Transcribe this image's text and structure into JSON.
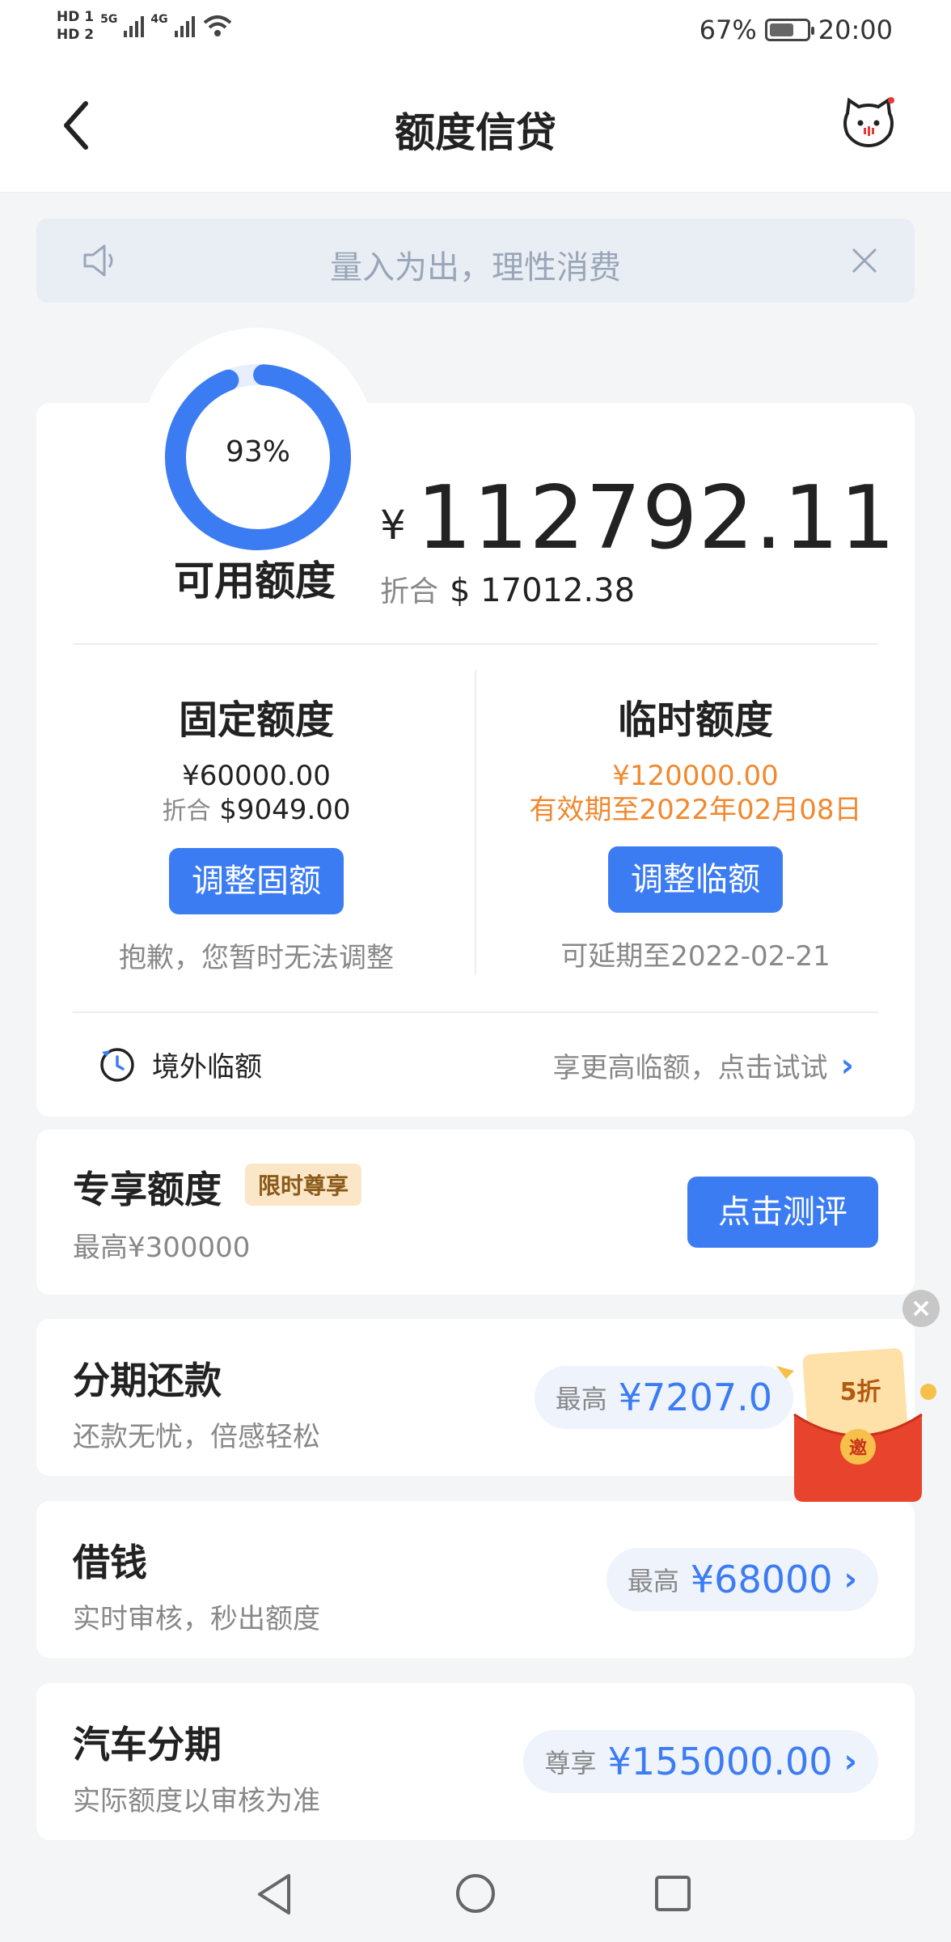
{
  "status_bar": {
    "hd1": "HD 1",
    "hd2": "HD 2",
    "net1": "5G",
    "net2": "4G",
    "battery": "67%",
    "battery_level": 0.67,
    "time": "20:00"
  },
  "header": {
    "title": "额度信贷"
  },
  "notice": {
    "text": "量入为出，理性消费"
  },
  "credit": {
    "ring_percent_label": "93%",
    "ring_percent": 93,
    "available_label": "可用额度",
    "currency_symbol": "¥",
    "available_amount": "112792.11",
    "usd_label": "折合",
    "usd_amount": "$ 17012.38"
  },
  "fixed": {
    "title": "固定额度",
    "amount": "¥60000.00",
    "usd_label": "折合",
    "usd_amount": "$9049.00",
    "button": "调整固额",
    "note": "抱歉，您暂时无法调整"
  },
  "temp": {
    "title": "临时额度",
    "amount": "¥120000.00",
    "validity": "有效期至2022年02月08日",
    "button": "调整临额",
    "note": "可延期至2022-02-21"
  },
  "overseas": {
    "label": "境外临额",
    "link": "享更高临额，点击试试"
  },
  "exclusive": {
    "title": "专享额度",
    "tag": "限时尊享",
    "sub": "最高¥300000",
    "button": "点击测评"
  },
  "products": [
    {
      "title": "分期还款",
      "sub": "还款无忧，倍感轻松",
      "pill_label": "最高",
      "pill_value": "¥7207.0"
    },
    {
      "title": "借钱",
      "sub": "实时审核，秒出额度",
      "pill_label": "最高",
      "pill_value": "¥68000"
    },
    {
      "title": "汽车分期",
      "sub": "实际额度以审核为准",
      "pill_label": "尊享",
      "pill_value": "¥155000.00"
    }
  ],
  "promo": {
    "discount": "5折",
    "invite": "邀"
  },
  "colors": {
    "accent": "#3c7cf3",
    "orange": "#f0892f",
    "background": "#f4f5f7"
  }
}
